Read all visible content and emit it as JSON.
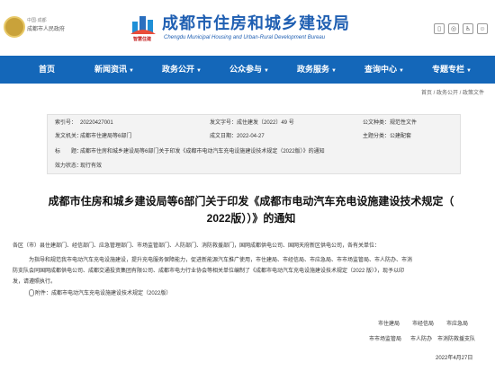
{
  "header": {
    "gov_label_top": "中国·成都",
    "gov_label": "成都市人民政府",
    "logo_caption": "智慧住建",
    "site_title": "成都市住房和城乡建设局",
    "site_subtitle": "Chengdu Municipal Housing and Urban-Rural Development Bureau",
    "icons": [
      "mobile-icon",
      "wechat-icon",
      "accessibility-icon",
      "elderly-icon"
    ]
  },
  "nav": {
    "items": [
      {
        "label": "首页",
        "dropdown": false
      },
      {
        "label": "新闻资讯",
        "dropdown": true
      },
      {
        "label": "政务公开",
        "dropdown": true
      },
      {
        "label": "公众参与",
        "dropdown": true
      },
      {
        "label": "政务服务",
        "dropdown": true
      },
      {
        "label": "查询中心",
        "dropdown": true
      },
      {
        "label": "专题专栏",
        "dropdown": true
      }
    ]
  },
  "breadcrumb": "首页 / 政务公开 / 政策文件",
  "info": {
    "index_label": "索引号：",
    "index_value": "20220427001",
    "doc_no_label": "发文字号：",
    "doc_no_value": "成住建发〔2022〕49 号",
    "category_label": "公文种类：",
    "category_value": "规范性文件",
    "issuer_label": "发文机关：",
    "issuer_value": "成都市住建局等6部门",
    "date_label": "成文日期：",
    "date_value": "2022-04-27",
    "theme_label": "主题分类：",
    "theme_value": "公建配套",
    "title_label": "标　　题：",
    "title_value": "成都市住房和城乡建设局等6部门关于印发《成都市电动汽车充电设施建设技术规定（2022版）》的通知",
    "status_label": "效力状态：",
    "status_value": "现行有效"
  },
  "article": {
    "title_line1": "成都市住房和城乡建设局等6部门关于印发《成都市电动汽车充电设施建设技术规定（",
    "title_line2": "2022版））》的通知",
    "salutation": "各区（市）县住建部门、经信部门、应急管理部门、市场监管部门、人防部门、消防救援部门，国网成都供电公司、国网天府新区供电公司，各有关单位：",
    "body_line1": "为指导和规范我市电动汽车充电设施建设，提升充电服务保障能力，促进新能源汽车推广使用，市住建局、市经信局、市应急局、市市场监管局、市人防办、市消",
    "body_line2": "防支队会同国网成都供电公司、成都交通投资集团有限公司、成都市电力行业协会等相关单位编制了《成都市电动汽车充电设施建设技术规定（2022 版）》，现予以印",
    "body_line3": "发，请遵照执行。",
    "attachment": "附件：成都市电动汽车充电设施建设技术规定（2022版）",
    "sig_row1": [
      "市住建局",
      "市经信局",
      "市应急局"
    ],
    "sig_row2": [
      "市市场监管局",
      "市人防办",
      "市消防救援支队"
    ],
    "sig_date": "2022年4月27日"
  },
  "colors": {
    "brand_blue": "#1467b9",
    "title_blue": "#1f5fb2",
    "info_bg": "#f3f3f3"
  }
}
